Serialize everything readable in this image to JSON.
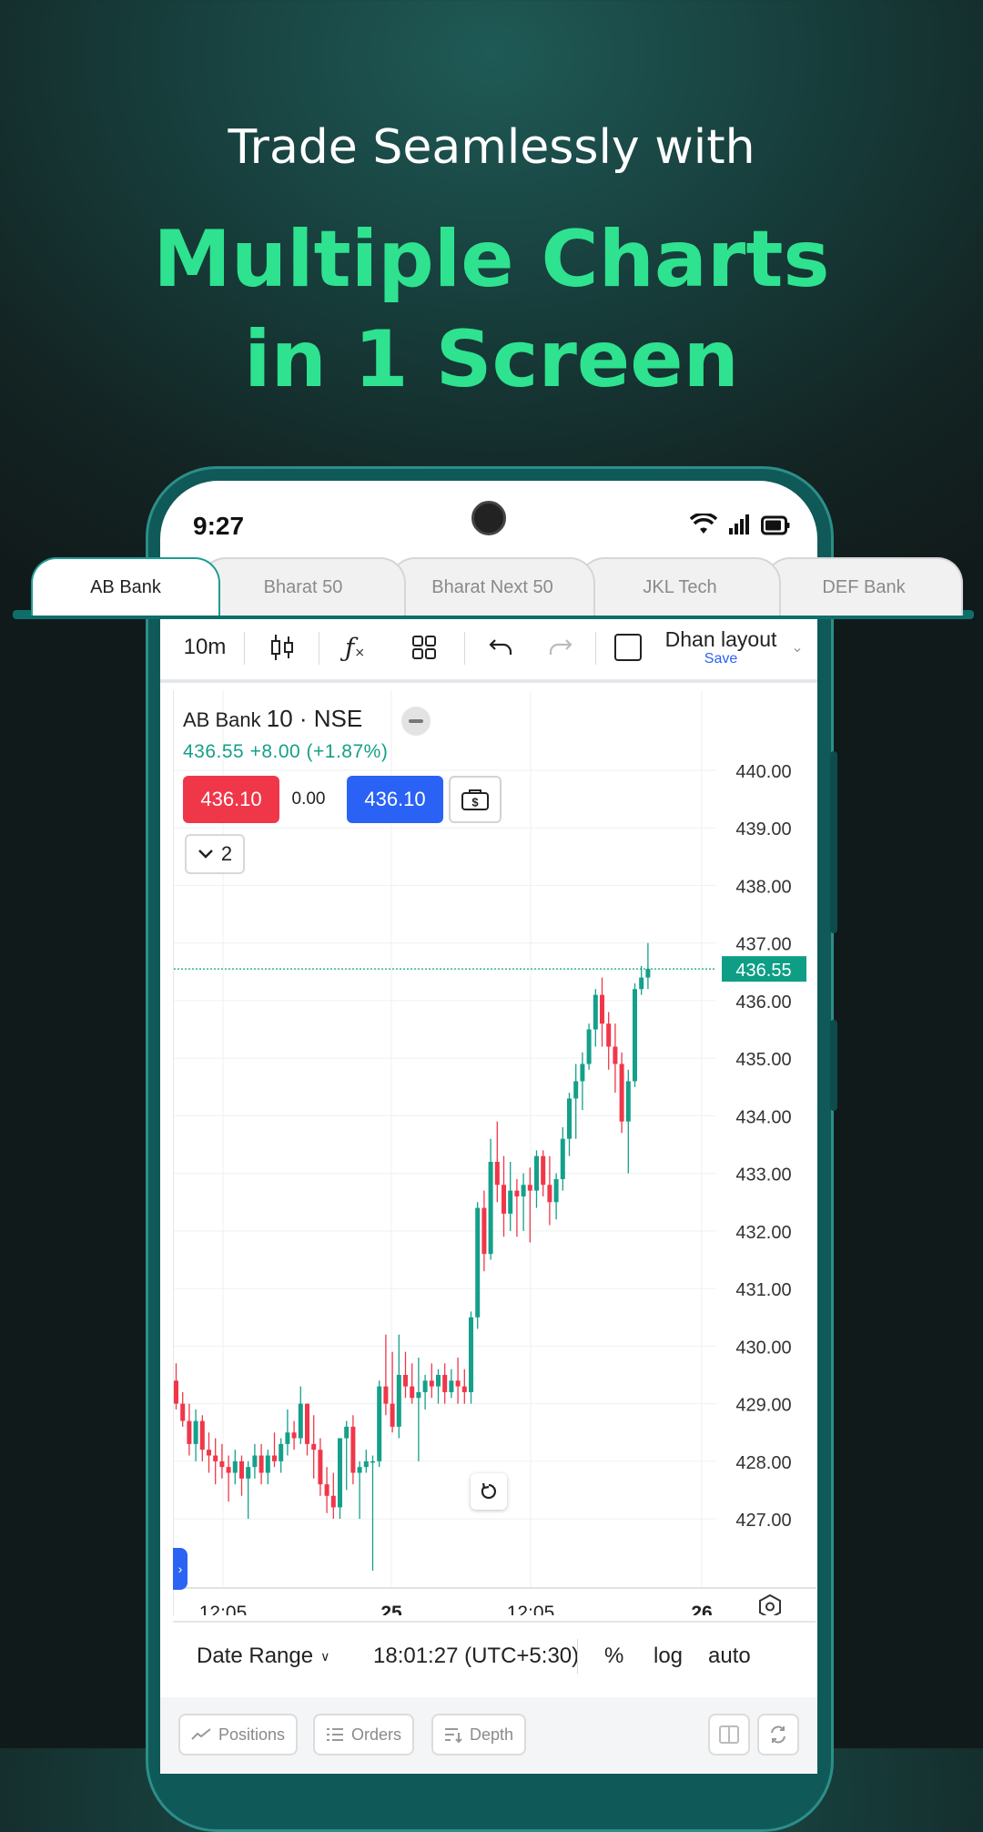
{
  "hero": {
    "line1": "Trade Seamlessly with",
    "line2": "Multiple Charts",
    "line3": "in 1 Screen"
  },
  "status_bar": {
    "time": "9:27"
  },
  "tabs": [
    {
      "label": "AB Bank",
      "active": true
    },
    {
      "label": "Bharat 50",
      "active": false
    },
    {
      "label": "Bharat Next 50",
      "active": false
    },
    {
      "label": "JKL Tech",
      "active": false
    },
    {
      "label": "DEF Bank",
      "active": false
    }
  ],
  "toolbar": {
    "interval": "10m",
    "layout_name": "Dhan layout",
    "save_label": "Save"
  },
  "legend": {
    "symbol": "AB Bank",
    "interval_exchange": "10 · NSE",
    "price_change": "436.55  +8.00 (+1.87%)",
    "sell_price": "436.10",
    "spread": "0.00",
    "buy_price": "436.10",
    "indicator_count": "2"
  },
  "chart_data": {
    "type": "candlestick",
    "y_ticks": [
      "440.00",
      "439.00",
      "438.00",
      "437.00",
      "436.00",
      "435.00",
      "434.00",
      "433.00",
      "432.00",
      "431.00",
      "430.00",
      "429.00",
      "428.00",
      "427.00"
    ],
    "ylim": [
      426.1,
      440.6
    ],
    "x_ticks": [
      {
        "label": "12:05",
        "bold": false
      },
      {
        "label": "25",
        "bold": true
      },
      {
        "label": "12:05",
        "bold": false
      },
      {
        "label": "26",
        "bold": true
      }
    ],
    "last_price": "436.55",
    "last_price_value": 436.55,
    "colors": {
      "up": "#14a08a",
      "down": "#f0374a",
      "last": "#0e9e86"
    },
    "candles": [
      [
        429.4,
        429.7,
        428.9,
        429.0
      ],
      [
        429.0,
        429.2,
        428.6,
        428.7
      ],
      [
        428.7,
        429.0,
        428.1,
        428.3
      ],
      [
        428.3,
        428.9,
        428.0,
        428.7
      ],
      [
        428.7,
        428.8,
        428.0,
        428.2
      ],
      [
        428.2,
        428.5,
        427.8,
        428.1
      ],
      [
        428.1,
        428.4,
        427.6,
        428.0
      ],
      [
        428.0,
        428.3,
        427.7,
        427.9
      ],
      [
        427.9,
        428.1,
        427.3,
        427.8
      ],
      [
        427.8,
        428.2,
        427.6,
        428.0
      ],
      [
        428.0,
        428.1,
        427.4,
        427.7
      ],
      [
        427.7,
        428.0,
        427.0,
        427.9
      ],
      [
        427.9,
        428.3,
        427.7,
        428.1
      ],
      [
        428.1,
        428.3,
        427.6,
        427.8
      ],
      [
        427.8,
        428.2,
        427.6,
        428.1
      ],
      [
        428.1,
        428.5,
        427.9,
        428.0
      ],
      [
        428.0,
        428.4,
        427.8,
        428.3
      ],
      [
        428.3,
        428.9,
        428.1,
        428.5
      ],
      [
        428.5,
        428.7,
        428.2,
        428.4
      ],
      [
        428.4,
        429.3,
        428.3,
        429.0
      ],
      [
        429.0,
        429.0,
        428.1,
        428.3
      ],
      [
        428.3,
        428.8,
        427.7,
        428.2
      ],
      [
        428.2,
        428.4,
        427.4,
        427.6
      ],
      [
        427.6,
        427.9,
        427.1,
        427.4
      ],
      [
        427.4,
        427.8,
        427.0,
        427.2
      ],
      [
        427.2,
        428.4,
        427.0,
        428.4
      ],
      [
        428.4,
        428.7,
        427.5,
        428.6
      ],
      [
        428.6,
        428.8,
        427.6,
        427.8
      ],
      [
        427.8,
        428.0,
        427.0,
        427.9
      ],
      [
        427.9,
        428.2,
        427.8,
        428.0
      ],
      [
        428.0,
        428.1,
        426.1,
        428.0
      ],
      [
        428.0,
        429.4,
        427.9,
        429.3
      ],
      [
        429.3,
        430.2,
        428.8,
        429.0
      ],
      [
        429.0,
        429.9,
        428.5,
        428.6
      ],
      [
        428.6,
        430.2,
        428.4,
        429.5
      ],
      [
        429.5,
        429.9,
        429.1,
        429.3
      ],
      [
        429.3,
        429.7,
        429.0,
        429.1
      ],
      [
        429.1,
        429.8,
        428.0,
        429.2
      ],
      [
        429.2,
        429.5,
        428.9,
        429.4
      ],
      [
        429.4,
        429.7,
        429.1,
        429.3
      ],
      [
        429.3,
        429.6,
        429.0,
        429.5
      ],
      [
        429.5,
        429.7,
        429.0,
        429.2
      ],
      [
        429.2,
        429.6,
        429.1,
        429.4
      ],
      [
        429.4,
        429.8,
        429.0,
        429.3
      ],
      [
        429.3,
        429.6,
        429.0,
        429.2
      ],
      [
        429.2,
        430.6,
        429.0,
        430.5
      ],
      [
        430.5,
        432.5,
        430.3,
        432.4
      ],
      [
        432.4,
        432.7,
        431.3,
        431.6
      ],
      [
        431.6,
        433.6,
        431.5,
        433.2
      ],
      [
        433.2,
        433.9,
        432.5,
        432.8
      ],
      [
        432.8,
        433.3,
        431.9,
        432.3
      ],
      [
        432.3,
        433.2,
        432.0,
        432.7
      ],
      [
        432.7,
        432.9,
        431.9,
        432.6
      ],
      [
        432.6,
        433.0,
        432.0,
        432.8
      ],
      [
        432.8,
        433.1,
        431.8,
        432.7
      ],
      [
        432.7,
        433.4,
        432.4,
        433.3
      ],
      [
        433.3,
        433.4,
        432.6,
        432.8
      ],
      [
        432.8,
        433.3,
        432.1,
        432.5
      ],
      [
        432.5,
        433.0,
        432.2,
        432.9
      ],
      [
        432.9,
        433.8,
        432.7,
        433.6
      ],
      [
        433.6,
        434.4,
        433.3,
        434.3
      ],
      [
        434.3,
        434.9,
        433.6,
        434.6
      ],
      [
        434.6,
        435.1,
        434.1,
        434.9
      ],
      [
        434.9,
        435.6,
        434.8,
        435.5
      ],
      [
        435.5,
        436.2,
        435.2,
        436.1
      ],
      [
        436.1,
        436.4,
        435.2,
        435.6
      ],
      [
        435.6,
        435.8,
        434.8,
        435.2
      ],
      [
        435.2,
        435.6,
        434.4,
        434.9
      ],
      [
        434.9,
        435.1,
        433.7,
        433.9
      ],
      [
        433.9,
        434.8,
        433.0,
        434.6
      ],
      [
        434.6,
        436.3,
        434.5,
        436.2
      ],
      [
        436.2,
        436.6,
        436.1,
        436.4
      ],
      [
        436.4,
        437.0,
        436.2,
        436.55
      ]
    ]
  },
  "bottom_bar": {
    "date_range": "Date Range",
    "time": "18:01:27 (UTC+5:30)",
    "percent": "%",
    "log": "log",
    "auto": "auto"
  },
  "footer": {
    "positions": "Positions",
    "orders": "Orders",
    "depth": "Depth"
  }
}
